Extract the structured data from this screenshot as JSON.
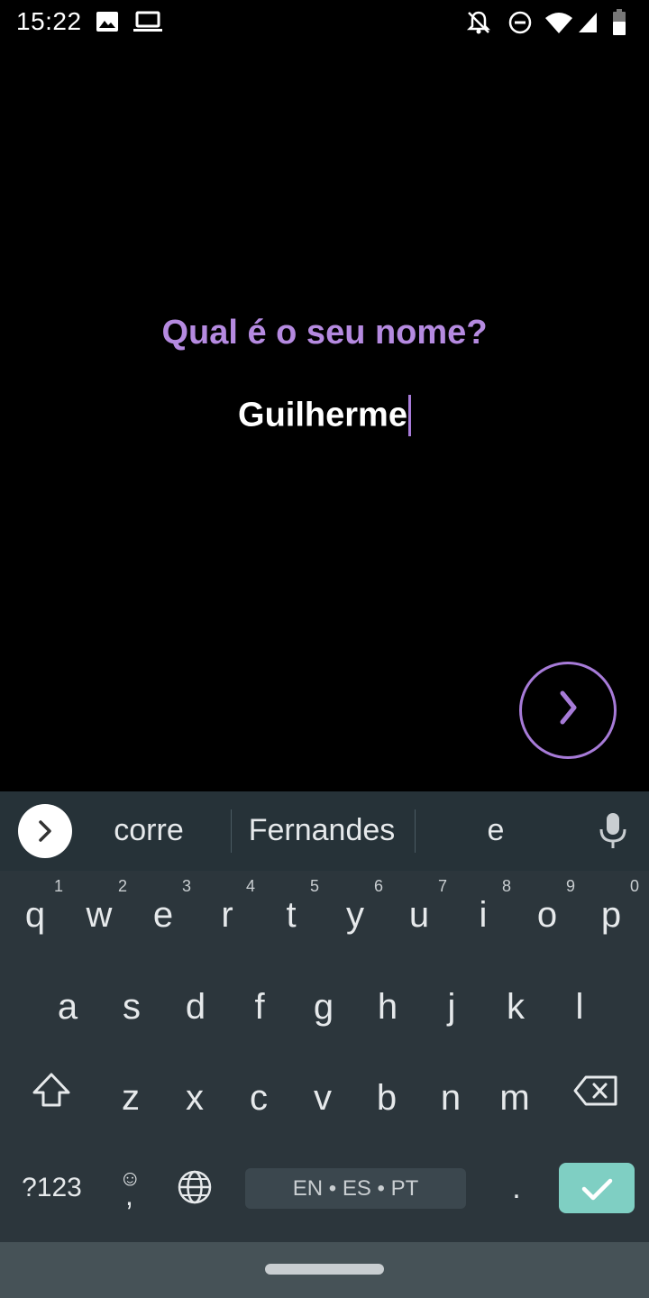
{
  "status_bar": {
    "time": "15:22",
    "left_icons": [
      "image-icon",
      "laptop-icon"
    ],
    "right_icons": [
      "notifications-off-icon",
      "do-not-disturb-icon",
      "wifi-icon",
      "cellular-signal-icon",
      "battery-icon"
    ]
  },
  "main": {
    "question": "Qual é o seu nome?",
    "name_value": "Guilherme",
    "next_icon": "chevron-right-icon"
  },
  "colors": {
    "accent": "#a77bd8",
    "keyboard_bg": "#2c363c",
    "enter_key": "#7fcfc3"
  },
  "keyboard": {
    "suggestions": [
      "corre",
      "Fernandes",
      "e"
    ],
    "row1": [
      "q",
      "w",
      "e",
      "r",
      "t",
      "y",
      "u",
      "i",
      "o",
      "p"
    ],
    "row1_hints": [
      "1",
      "2",
      "3",
      "4",
      "5",
      "6",
      "7",
      "8",
      "9",
      "0"
    ],
    "row2": [
      "a",
      "s",
      "d",
      "f",
      "g",
      "h",
      "j",
      "k",
      "l"
    ],
    "row3": [
      "z",
      "x",
      "c",
      "v",
      "b",
      "n",
      "m"
    ],
    "symbols_label": "?123",
    "comma": ",",
    "space_label": "EN • ES • PT",
    "period": "."
  }
}
